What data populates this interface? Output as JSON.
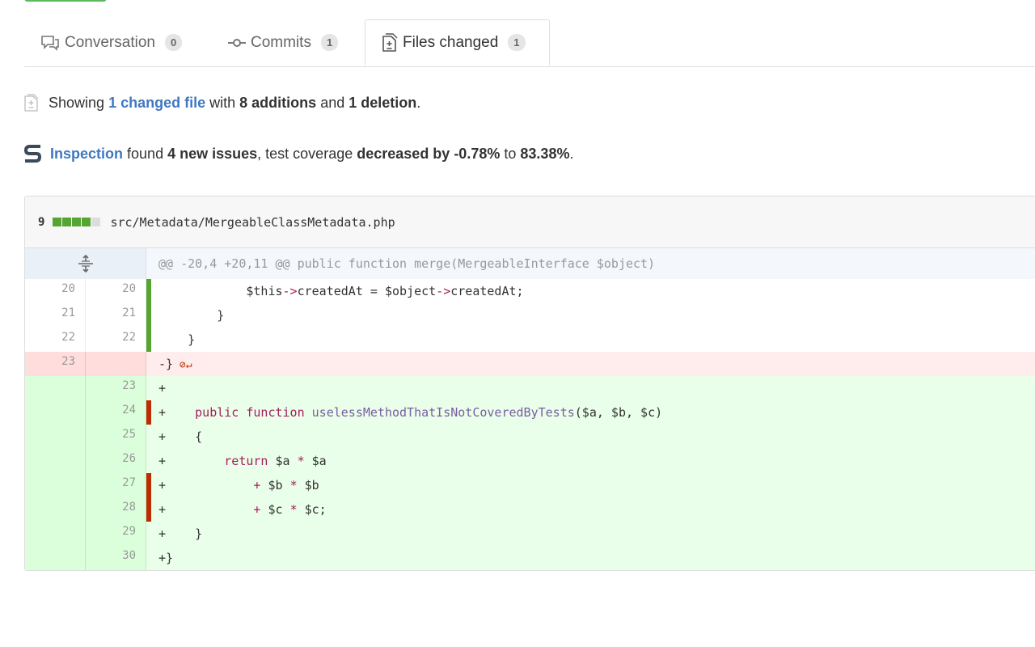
{
  "tabs": [
    {
      "label": "Conversation",
      "count": "0",
      "icon": "comment-icon"
    },
    {
      "label": "Commits",
      "count": "1",
      "icon": "commit-icon"
    },
    {
      "label": "Files changed",
      "count": "1",
      "icon": "file-diff-icon"
    }
  ],
  "summary": {
    "prefix": "Showing",
    "link": "1 changed file",
    "mid": "with",
    "additions": "8 additions",
    "and": "and",
    "deletions": "1 deletion",
    "end": "."
  },
  "inspection": {
    "link": "Inspection",
    "t1": "found",
    "issues": "4 new issues",
    "t2": ", test coverage",
    "decrease": "decreased by -0.78%",
    "t3": "to",
    "coverage": "83.38%",
    "end": "."
  },
  "file": {
    "changes": "9",
    "path": "src/Metadata/MergeableClassMetadata.php"
  },
  "hunk_header": "@@ -20,4 +20,11 @@ public function merge(MergeableInterface $object)",
  "lines": [
    {
      "old": "20",
      "new": "20",
      "type": "ctx"
    },
    {
      "old": "21",
      "new": "21",
      "type": "ctx"
    },
    {
      "old": "22",
      "new": "22",
      "type": "ctx"
    },
    {
      "old": "23",
      "new": "",
      "type": "del"
    },
    {
      "old": "",
      "new": "23",
      "type": "add"
    },
    {
      "old": "",
      "new": "24",
      "type": "add"
    },
    {
      "old": "",
      "new": "25",
      "type": "add"
    },
    {
      "old": "",
      "new": "26",
      "type": "add"
    },
    {
      "old": "",
      "new": "27",
      "type": "add"
    },
    {
      "old": "",
      "new": "28",
      "type": "add"
    },
    {
      "old": "",
      "new": "29",
      "type": "add"
    },
    {
      "old": "",
      "new": "30",
      "type": "add"
    }
  ],
  "code": {
    "l1_a": "$this",
    "l1_b": "->",
    "l1_c": "createdAt = ",
    "l1_d": "$object",
    "l1_e": "->",
    "l1_f": "createdAt;",
    "l2": "}",
    "l3": "}",
    "l4": "-}",
    "l5": "+",
    "l6_kw1": "public",
    "l6_kw2": "function",
    "l6_fn": "uselessMethodThatIsNotCoveredByTests",
    "l6_args": "($a, $b, $c)",
    "l7": "{",
    "l8_kw": "return",
    "l8_a": "$a ",
    "l8_op": "*",
    "l8_b": " $a",
    "l9_op1": "+",
    "l9_a": " $b ",
    "l9_op2": "*",
    "l9_b": " $b",
    "l10_op1": "+",
    "l10_a": " $c ",
    "l10_op2": "*",
    "l10_b": " $c;",
    "l11": "}",
    "l12": "+}"
  },
  "colors": {
    "added_bar": "#55a532",
    "removed_bar": "#bd2c00",
    "link": "#4078c0"
  }
}
